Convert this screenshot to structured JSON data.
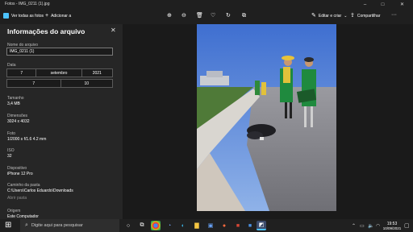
{
  "window": {
    "title": "Fotos - IMG_0211 (1).jpg",
    "controls": [
      "–",
      "□",
      "✕"
    ]
  },
  "toolbar": {
    "view_all": "Ver todas as fotos",
    "add": "Adicionar a",
    "edit_create": "Editar e criar",
    "share": "Compartilhar",
    "more": "···"
  },
  "info": {
    "title": "Informações do arquivo",
    "filename_label": "Nome do arquivo",
    "filename_value": "IMG_0211 (1)",
    "date_label": "Data",
    "date_day": "7",
    "date_month": "setembro",
    "date_year": "2021",
    "time_hour": "7",
    "time_minute": "10",
    "size_label": "Tamanho",
    "size_value": "3,4 MB",
    "dimensions_label": "Dimensões",
    "dimensions_value": "3024 x 4032",
    "photo_label": "Foto",
    "photo_value": "1/2000 s f/1.6 4.2 mm",
    "iso_label": "ISO",
    "iso_value": "32",
    "device_label": "Dispositivo",
    "device_value": "iPhone 12 Pro",
    "path_label": "Caminho da pasta",
    "path_value": "C:\\Users\\Carlos Eduardo\\Downloads",
    "open_folder": "Abrir pasta",
    "origin_label": "Origem",
    "origin_value": "Este Computador"
  },
  "taskbar": {
    "search_placeholder": "Digite aqui para pesquisar",
    "time": "19:53",
    "date": "10/09/2021"
  },
  "colors": {
    "accent": "#4cc2ff",
    "panel": "#262626",
    "background": "#1a1a1a"
  }
}
